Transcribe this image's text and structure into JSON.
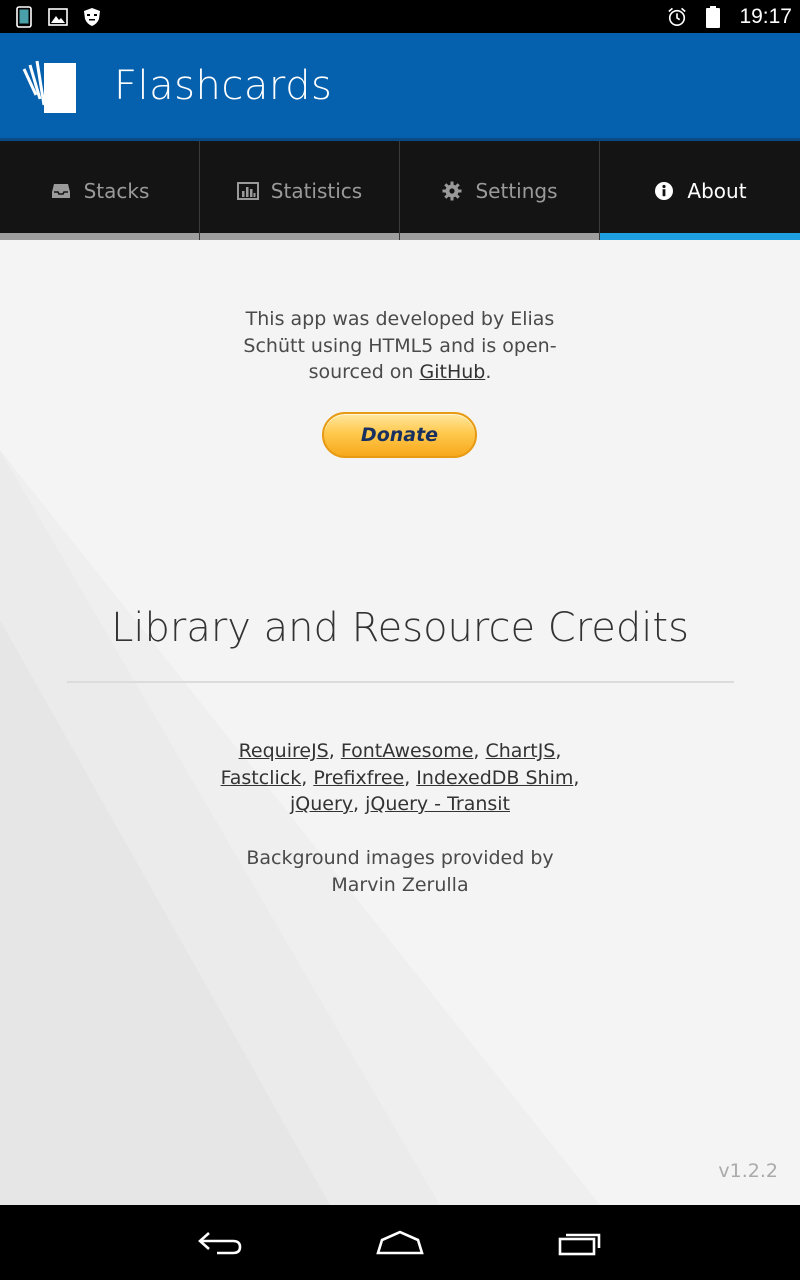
{
  "status_bar": {
    "time": "19:17",
    "left_icons": [
      "tablet-icon",
      "image-icon",
      "shield-icon"
    ],
    "right_icons": [
      "alarm-icon",
      "battery-icon"
    ]
  },
  "app_bar": {
    "title": "Flashcards",
    "logo_icon": "cards-logo-icon",
    "background_color": "#0560ad"
  },
  "tabs": [
    {
      "label": "Stacks",
      "icon": "inbox-icon",
      "active": false
    },
    {
      "label": "Statistics",
      "icon": "bar-chart-icon",
      "active": false
    },
    {
      "label": "Settings",
      "icon": "gear-icon",
      "active": false
    },
    {
      "label": "About",
      "icon": "info-icon",
      "active": true
    }
  ],
  "tab_accent_color": "#1ea0e0",
  "about": {
    "intro_line1": "This app was developed by Elias",
    "intro_line2": "Schütt using HTML5 and is open-",
    "intro_line3_prefix": "sourced on ",
    "github_link": "GitHub",
    "intro_line3_suffix": ".",
    "donate_label": "Donate",
    "credits_title": "Library and Resource Credits",
    "libraries": [
      "RequireJS",
      "FontAwesome",
      "ChartJS",
      "Fastclick",
      "Prefixfree",
      "IndexedDB Shim",
      "jQuery",
      "jQuery - Transit"
    ],
    "lib_separator": ", ",
    "bg_credit_line1": "Background images provided by",
    "bg_credit_line2": "Marvin Zerulla",
    "version": "v1.2.2"
  },
  "nav_bar": {
    "buttons": [
      "back-icon",
      "home-icon",
      "recent-apps-icon"
    ]
  }
}
